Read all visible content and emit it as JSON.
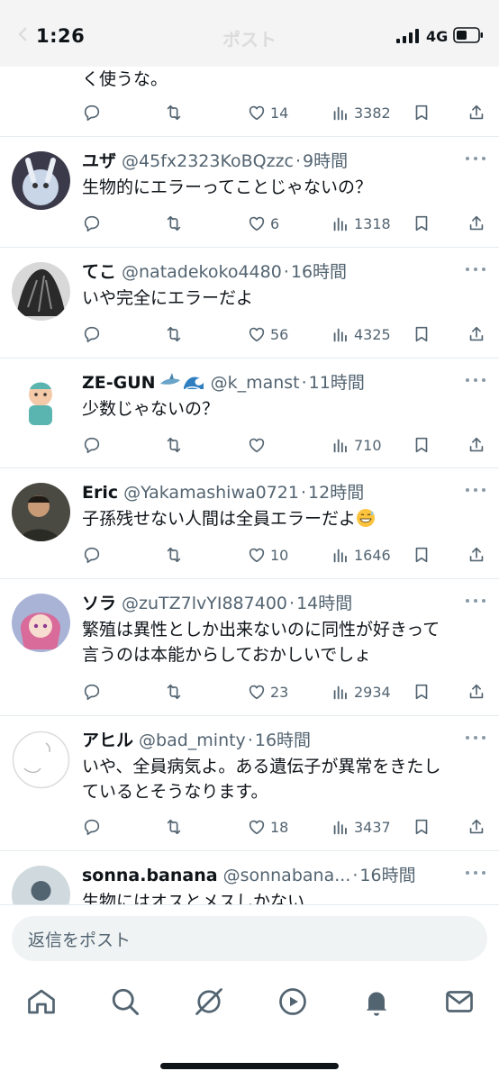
{
  "status_bar": {
    "time": "1:26",
    "network": "4G"
  },
  "header": {
    "title": "ポスト"
  },
  "partial_post": {
    "text": "く使うな。",
    "replies": "",
    "retweets": "",
    "likes": "14",
    "views": "3382"
  },
  "posts": [
    {
      "name": "ユザ",
      "handle": "@45fx2323KoBQzzc",
      "time": "9時間",
      "text": "生物的にエラーってことじゃないの？",
      "likes": "6",
      "views": "1318"
    },
    {
      "name": "てこ",
      "handle": "@natadekoko4480",
      "time": "16時間",
      "text": "いや完全にエラーだよ",
      "likes": "56",
      "views": "4325"
    },
    {
      "name": "ZE-GUN",
      "handle": "@k_manst",
      "time": "11時間",
      "text": "少数じゃないの？",
      "likes": "",
      "views": "710"
    },
    {
      "name": "Eric",
      "handle": "@Yakamashiwa0721",
      "time": "12時間",
      "text": "子孫残せない人間は全員エラーだよ",
      "likes": "10",
      "views": "1646"
    },
    {
      "name": "ソラ",
      "handle": "@zuTZ7lvYI887400",
      "time": "14時間",
      "text_line1": "繁殖は異性としか出来ないのに同性が好きって",
      "text_line2": "言うのは本能からしておかしいでしょ",
      "likes": "23",
      "views": "2934"
    },
    {
      "name": "アヒル",
      "handle": "@bad_minty",
      "time": "16時間",
      "text_line1": "いや、全員病気よ。ある遺伝子が異常をきたし",
      "text_line2": "ているとそうなります。",
      "likes": "18",
      "views": "3437"
    },
    {
      "name": "sonna.banana",
      "handle": "@sonnabana...",
      "time": "16時間",
      "text": "生物にはオスとメスしかない"
    }
  ],
  "reply_bar": {
    "placeholder": "返信をポスト"
  },
  "nav": [
    "home-icon",
    "search-icon",
    "grok-icon",
    "video-icon",
    "notifications-icon",
    "messages-icon"
  ],
  "colors": {
    "text": "#0f1419",
    "secondary": "#536471",
    "divider": "#e6ecf0",
    "input_bg": "#eff3f4"
  }
}
